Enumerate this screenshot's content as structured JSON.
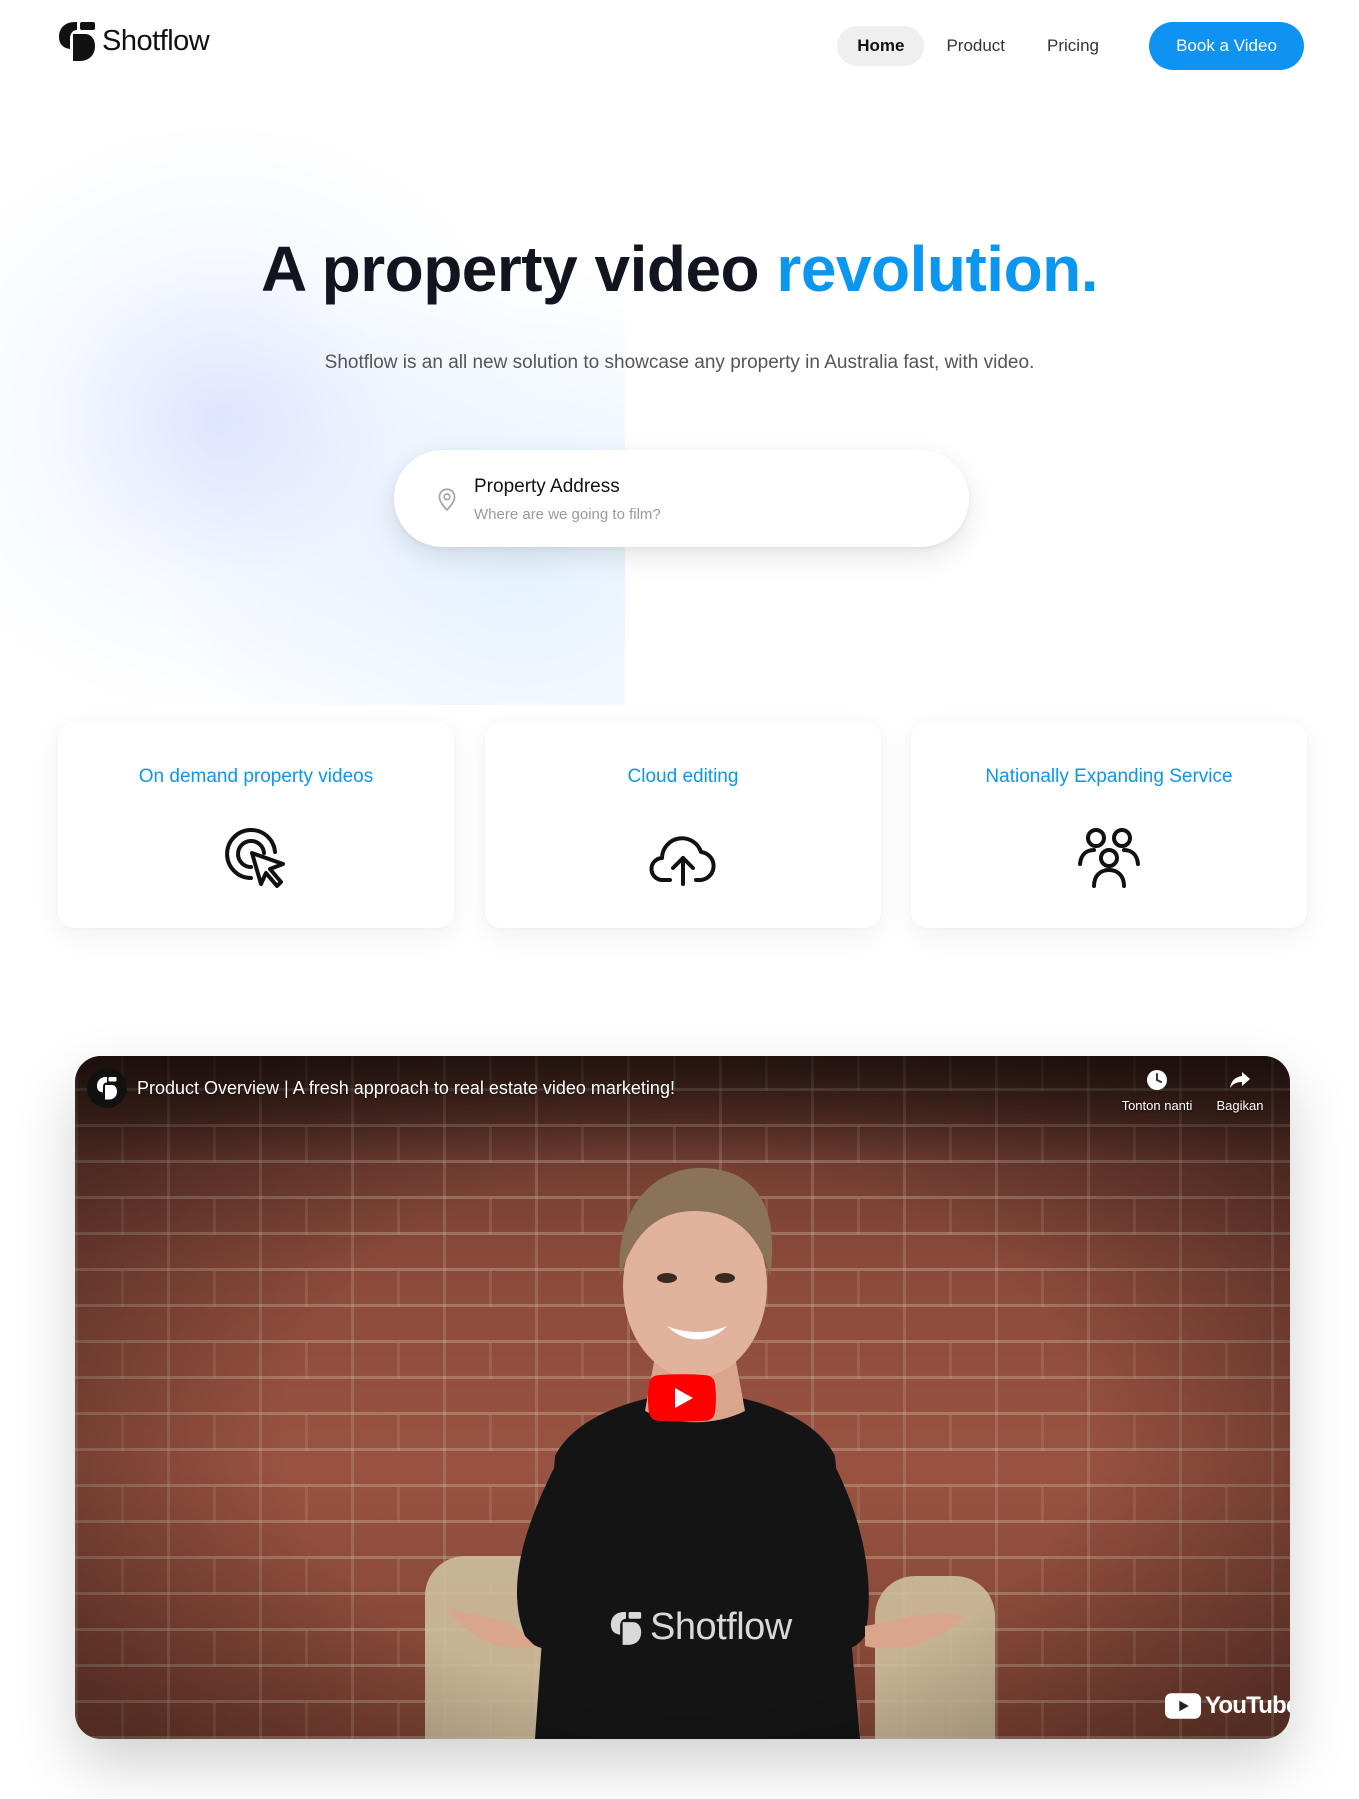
{
  "nav": {
    "brand": "Shotflow",
    "links": [
      {
        "label": "Home",
        "active": true
      },
      {
        "label": "Product",
        "active": false
      },
      {
        "label": "Pricing",
        "active": false
      }
    ],
    "cta_label": "Book a Video"
  },
  "hero": {
    "title_main": "A property video ",
    "title_accent": "revolution.",
    "subtitle": "Shotflow is an all new solution to showcase any property in Australia fast, with video."
  },
  "search": {
    "label": "Property Address",
    "placeholder": "Where are we going to film?",
    "icon": "map-pin-icon"
  },
  "features": [
    {
      "title": "On demand property videos",
      "icon": "cursor-click-icon"
    },
    {
      "title": "Cloud editing",
      "icon": "cloud-upload-icon"
    },
    {
      "title": "Nationally Expanding Service",
      "icon": "users-icon"
    }
  ],
  "video": {
    "title": "Product Overview | A fresh approach to real estate video marketing!",
    "watch_later_label": "Tonton nanti",
    "share_label": "Bagikan",
    "shirt_text": "Shotflow",
    "platform": "YouTube"
  },
  "colors": {
    "accent": "#0b96f0",
    "cta": "#0f93f2",
    "heading": "#121420",
    "youtube_red": "#ff0000"
  }
}
